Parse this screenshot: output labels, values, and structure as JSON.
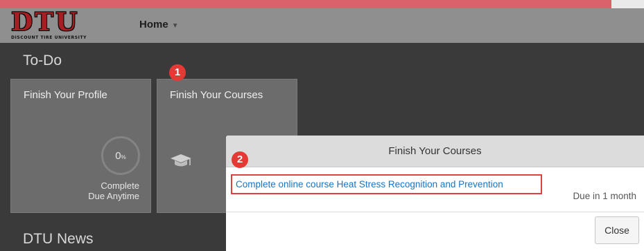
{
  "header": {
    "logo_text": "DTU",
    "logo_subtitle": "DISCOUNT TIRE UNIVERSITY",
    "home_label": "Home"
  },
  "todo": {
    "title": "To-Do",
    "cards": [
      {
        "title": "Finish Your Profile",
        "progress_value": "0",
        "progress_unit": "%",
        "status_line1": "Complete",
        "status_line2": "Due Anytime"
      },
      {
        "title": "Finish Your Courses"
      }
    ]
  },
  "news": {
    "title": "DTU News"
  },
  "dialog": {
    "title": "Finish Your Courses",
    "course_link": "Complete online course Heat Stress Recognition and Prevention",
    "due": "Due in 1 month",
    "close_label": "Close"
  },
  "annotations": {
    "badge1": "1",
    "badge2": "2"
  },
  "colors": {
    "accent_stripe": "#d9636a",
    "logo_red": "#a51f22",
    "link_blue": "#1a73c2",
    "badge_red": "#e53935",
    "highlight_border": "#e04040"
  }
}
